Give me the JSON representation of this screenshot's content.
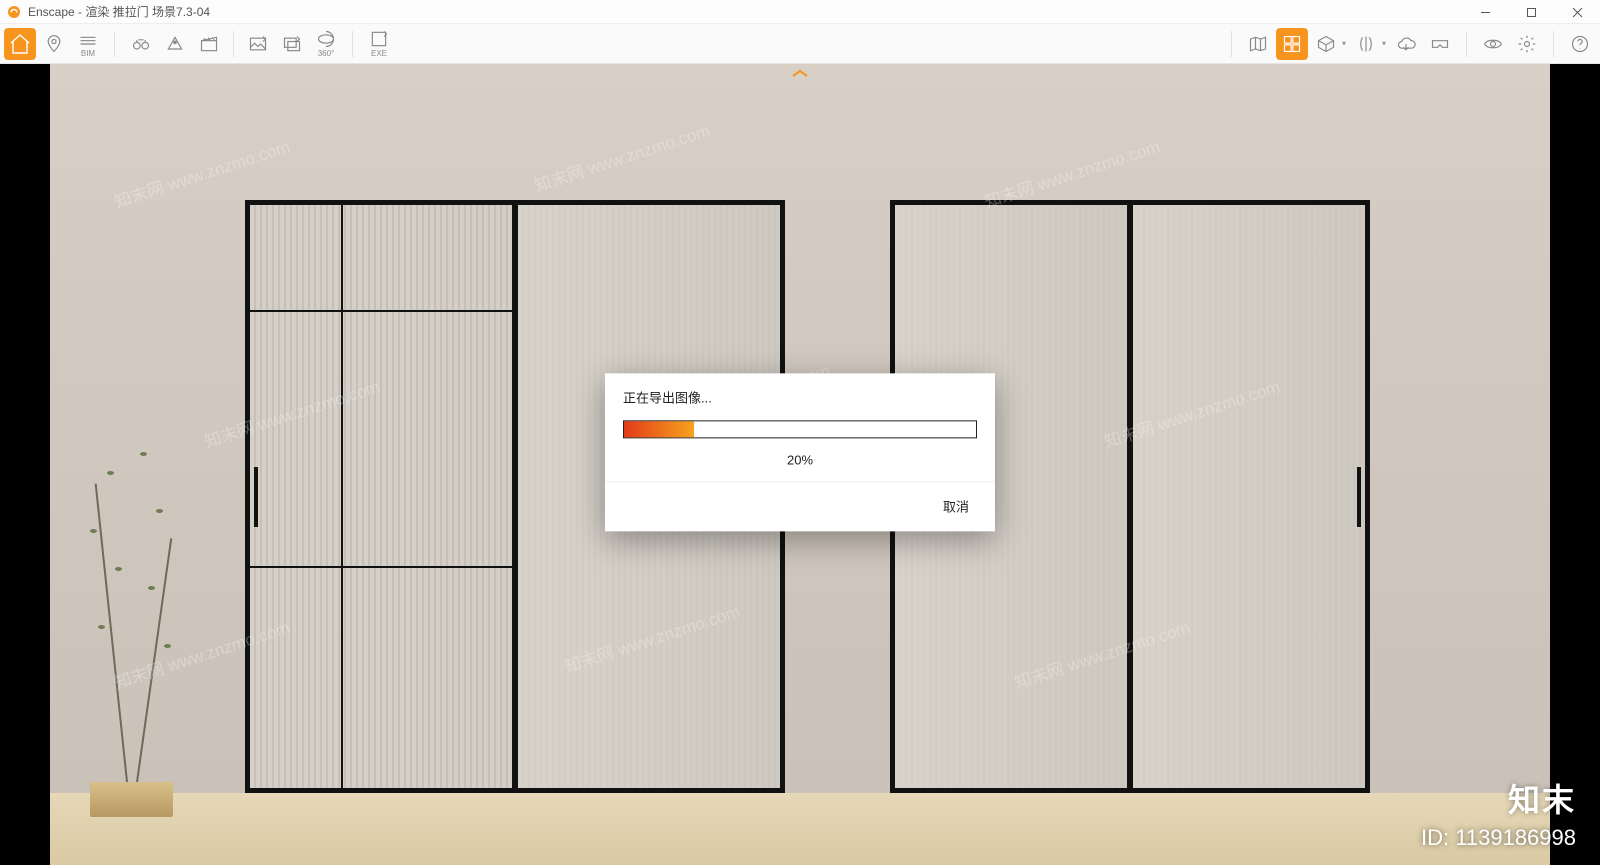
{
  "window": {
    "title": "Enscape - 渲染 推拉门 场景7.3-04",
    "min_tooltip": "Minimize",
    "max_tooltip": "Maximize",
    "close_tooltip": "Close"
  },
  "toolbar": {
    "left": [
      {
        "name": "home-icon",
        "active": true
      },
      {
        "name": "location-pin-icon"
      },
      {
        "name": "bim-icon",
        "label": "BIM"
      },
      {
        "name": "binoculars-icon"
      },
      {
        "name": "view-cone-icon"
      },
      {
        "name": "clapper-icon"
      }
    ],
    "mid": [
      {
        "name": "export-image-icon"
      },
      {
        "name": "export-batch-icon"
      },
      {
        "name": "export-360-icon",
        "label": "360°"
      },
      {
        "name": "export-exe-icon",
        "label": "EXE"
      }
    ],
    "right": [
      {
        "name": "map-icon"
      },
      {
        "name": "asset-library-icon",
        "active": true
      },
      {
        "name": "cube-icon",
        "caret": true
      },
      {
        "name": "mirror-columns-icon",
        "caret": true
      },
      {
        "name": "cloud-share-icon"
      },
      {
        "name": "vr-headset-icon"
      },
      {
        "name": "visibility-icon"
      },
      {
        "name": "gear-icon"
      },
      {
        "name": "help-icon"
      }
    ]
  },
  "dialog": {
    "title": "正在导出图像...",
    "percent_text": "20%",
    "percent_value": 20,
    "cancel": "取消"
  },
  "overlay": {
    "brand": "知末",
    "id_label": "ID: 1139186998",
    "watermark_text": "知末网 www.znzmo.com"
  }
}
